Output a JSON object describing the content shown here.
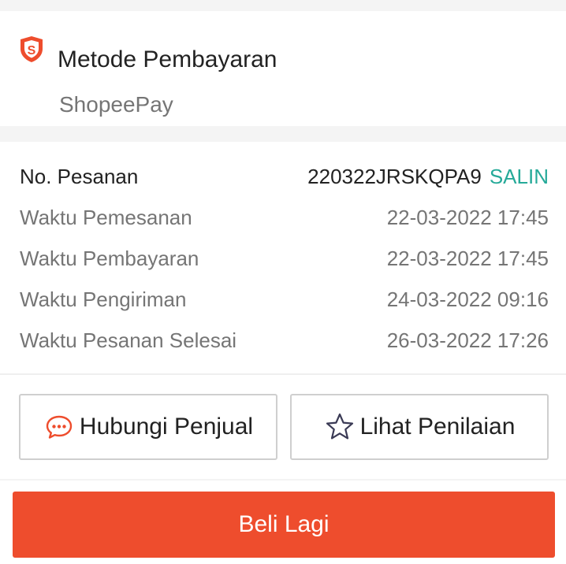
{
  "payment": {
    "title": "Metode Pembayaran",
    "method": "ShopeePay",
    "icon": "shopee-shield-icon"
  },
  "order_info": {
    "order_number_label": "No. Pesanan",
    "order_number": "220322JRSKQPA9",
    "copy_label": "SALIN",
    "rows": [
      {
        "label": "Waktu Pemesanan",
        "value": "22-03-2022 17:45"
      },
      {
        "label": "Waktu Pembayaran",
        "value": "22-03-2022 17:45"
      },
      {
        "label": "Waktu Pengiriman",
        "value": "24-03-2022 09:16"
      },
      {
        "label": "Waktu Pesanan Selesai",
        "value": "26-03-2022 17:26"
      }
    ]
  },
  "actions": {
    "chat_label": "Hubungi Penjual",
    "chat_icon": "chat-bubble-icon",
    "review_label": "Lihat Penilaian",
    "review_icon": "star-outline-icon"
  },
  "bottom": {
    "buy_again_label": "Beli Lagi"
  },
  "colors": {
    "brand": "#ee4d2d",
    "copy_accent": "#26aa99",
    "muted_text": "#757575",
    "primary_text": "#222222"
  }
}
